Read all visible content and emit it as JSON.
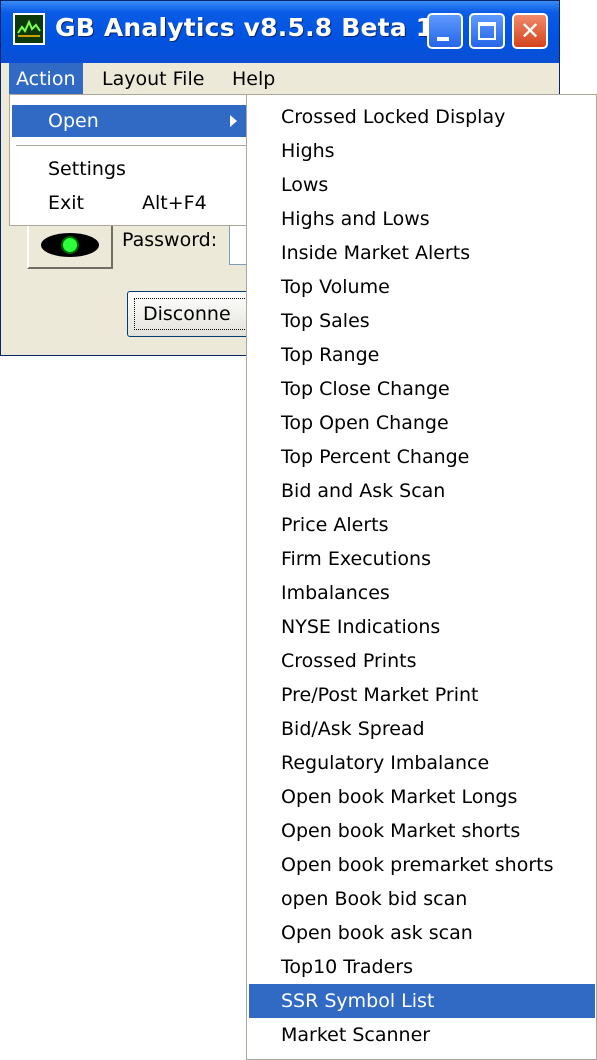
{
  "window": {
    "title": "GB Analytics v8.5.8 Beta 1",
    "close_glyph": "✕"
  },
  "menubar": {
    "action": "Action",
    "layout_file": "Layout File",
    "help": "Help"
  },
  "action_menu": {
    "open": "Open",
    "settings": "Settings",
    "exit": "Exit",
    "exit_shortcut": "Alt+F4"
  },
  "form": {
    "password_label": "Password:",
    "disconnect_label": "Disconne"
  },
  "open_submenu": {
    "items": [
      "Crossed Locked Display",
      "Highs",
      "Lows",
      "Highs and Lows",
      "Inside Market Alerts",
      "Top Volume",
      "Top Sales",
      "Top Range",
      "Top Close Change",
      "Top Open Change",
      "Top Percent Change",
      "Bid and Ask Scan",
      "Price Alerts",
      "Firm Executions",
      "Imbalances",
      "NYSE Indications",
      "Crossed Prints",
      "Pre/Post Market Print",
      "Bid/Ask Spread",
      "Regulatory Imbalance",
      "Open book Market Longs",
      "Open book Market shorts",
      "Open book premarket shorts",
      "open Book bid scan",
      "Open book ask scan",
      "Top10 Traders",
      "SSR Symbol List",
      "Market Scanner"
    ],
    "selected_index": 26
  },
  "colors": {
    "highlight": "#316ac5",
    "titlebar": "#0053e0",
    "window_bg": "#ece9d8"
  }
}
